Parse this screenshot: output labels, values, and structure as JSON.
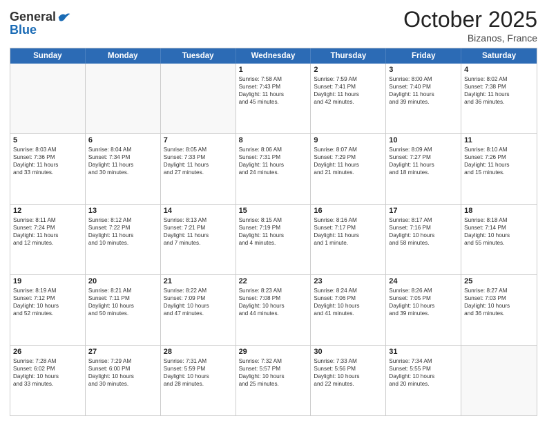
{
  "header": {
    "logo_line1": "General",
    "logo_line2": "Blue",
    "month": "October 2025",
    "location": "Bizanos, France"
  },
  "weekdays": [
    "Sunday",
    "Monday",
    "Tuesday",
    "Wednesday",
    "Thursday",
    "Friday",
    "Saturday"
  ],
  "rows": [
    [
      {
        "day": "",
        "info": ""
      },
      {
        "day": "",
        "info": ""
      },
      {
        "day": "",
        "info": ""
      },
      {
        "day": "1",
        "info": "Sunrise: 7:58 AM\nSunset: 7:43 PM\nDaylight: 11 hours\nand 45 minutes."
      },
      {
        "day": "2",
        "info": "Sunrise: 7:59 AM\nSunset: 7:41 PM\nDaylight: 11 hours\nand 42 minutes."
      },
      {
        "day": "3",
        "info": "Sunrise: 8:00 AM\nSunset: 7:40 PM\nDaylight: 11 hours\nand 39 minutes."
      },
      {
        "day": "4",
        "info": "Sunrise: 8:02 AM\nSunset: 7:38 PM\nDaylight: 11 hours\nand 36 minutes."
      }
    ],
    [
      {
        "day": "5",
        "info": "Sunrise: 8:03 AM\nSunset: 7:36 PM\nDaylight: 11 hours\nand 33 minutes."
      },
      {
        "day": "6",
        "info": "Sunrise: 8:04 AM\nSunset: 7:34 PM\nDaylight: 11 hours\nand 30 minutes."
      },
      {
        "day": "7",
        "info": "Sunrise: 8:05 AM\nSunset: 7:33 PM\nDaylight: 11 hours\nand 27 minutes."
      },
      {
        "day": "8",
        "info": "Sunrise: 8:06 AM\nSunset: 7:31 PM\nDaylight: 11 hours\nand 24 minutes."
      },
      {
        "day": "9",
        "info": "Sunrise: 8:07 AM\nSunset: 7:29 PM\nDaylight: 11 hours\nand 21 minutes."
      },
      {
        "day": "10",
        "info": "Sunrise: 8:09 AM\nSunset: 7:27 PM\nDaylight: 11 hours\nand 18 minutes."
      },
      {
        "day": "11",
        "info": "Sunrise: 8:10 AM\nSunset: 7:26 PM\nDaylight: 11 hours\nand 15 minutes."
      }
    ],
    [
      {
        "day": "12",
        "info": "Sunrise: 8:11 AM\nSunset: 7:24 PM\nDaylight: 11 hours\nand 12 minutes."
      },
      {
        "day": "13",
        "info": "Sunrise: 8:12 AM\nSunset: 7:22 PM\nDaylight: 11 hours\nand 10 minutes."
      },
      {
        "day": "14",
        "info": "Sunrise: 8:13 AM\nSunset: 7:21 PM\nDaylight: 11 hours\nand 7 minutes."
      },
      {
        "day": "15",
        "info": "Sunrise: 8:15 AM\nSunset: 7:19 PM\nDaylight: 11 hours\nand 4 minutes."
      },
      {
        "day": "16",
        "info": "Sunrise: 8:16 AM\nSunset: 7:17 PM\nDaylight: 11 hours\nand 1 minute."
      },
      {
        "day": "17",
        "info": "Sunrise: 8:17 AM\nSunset: 7:16 PM\nDaylight: 10 hours\nand 58 minutes."
      },
      {
        "day": "18",
        "info": "Sunrise: 8:18 AM\nSunset: 7:14 PM\nDaylight: 10 hours\nand 55 minutes."
      }
    ],
    [
      {
        "day": "19",
        "info": "Sunrise: 8:19 AM\nSunset: 7:12 PM\nDaylight: 10 hours\nand 52 minutes."
      },
      {
        "day": "20",
        "info": "Sunrise: 8:21 AM\nSunset: 7:11 PM\nDaylight: 10 hours\nand 50 minutes."
      },
      {
        "day": "21",
        "info": "Sunrise: 8:22 AM\nSunset: 7:09 PM\nDaylight: 10 hours\nand 47 minutes."
      },
      {
        "day": "22",
        "info": "Sunrise: 8:23 AM\nSunset: 7:08 PM\nDaylight: 10 hours\nand 44 minutes."
      },
      {
        "day": "23",
        "info": "Sunrise: 8:24 AM\nSunset: 7:06 PM\nDaylight: 10 hours\nand 41 minutes."
      },
      {
        "day": "24",
        "info": "Sunrise: 8:26 AM\nSunset: 7:05 PM\nDaylight: 10 hours\nand 39 minutes."
      },
      {
        "day": "25",
        "info": "Sunrise: 8:27 AM\nSunset: 7:03 PM\nDaylight: 10 hours\nand 36 minutes."
      }
    ],
    [
      {
        "day": "26",
        "info": "Sunrise: 7:28 AM\nSunset: 6:02 PM\nDaylight: 10 hours\nand 33 minutes."
      },
      {
        "day": "27",
        "info": "Sunrise: 7:29 AM\nSunset: 6:00 PM\nDaylight: 10 hours\nand 30 minutes."
      },
      {
        "day": "28",
        "info": "Sunrise: 7:31 AM\nSunset: 5:59 PM\nDaylight: 10 hours\nand 28 minutes."
      },
      {
        "day": "29",
        "info": "Sunrise: 7:32 AM\nSunset: 5:57 PM\nDaylight: 10 hours\nand 25 minutes."
      },
      {
        "day": "30",
        "info": "Sunrise: 7:33 AM\nSunset: 5:56 PM\nDaylight: 10 hours\nand 22 minutes."
      },
      {
        "day": "31",
        "info": "Sunrise: 7:34 AM\nSunset: 5:55 PM\nDaylight: 10 hours\nand 20 minutes."
      },
      {
        "day": "",
        "info": ""
      }
    ]
  ]
}
